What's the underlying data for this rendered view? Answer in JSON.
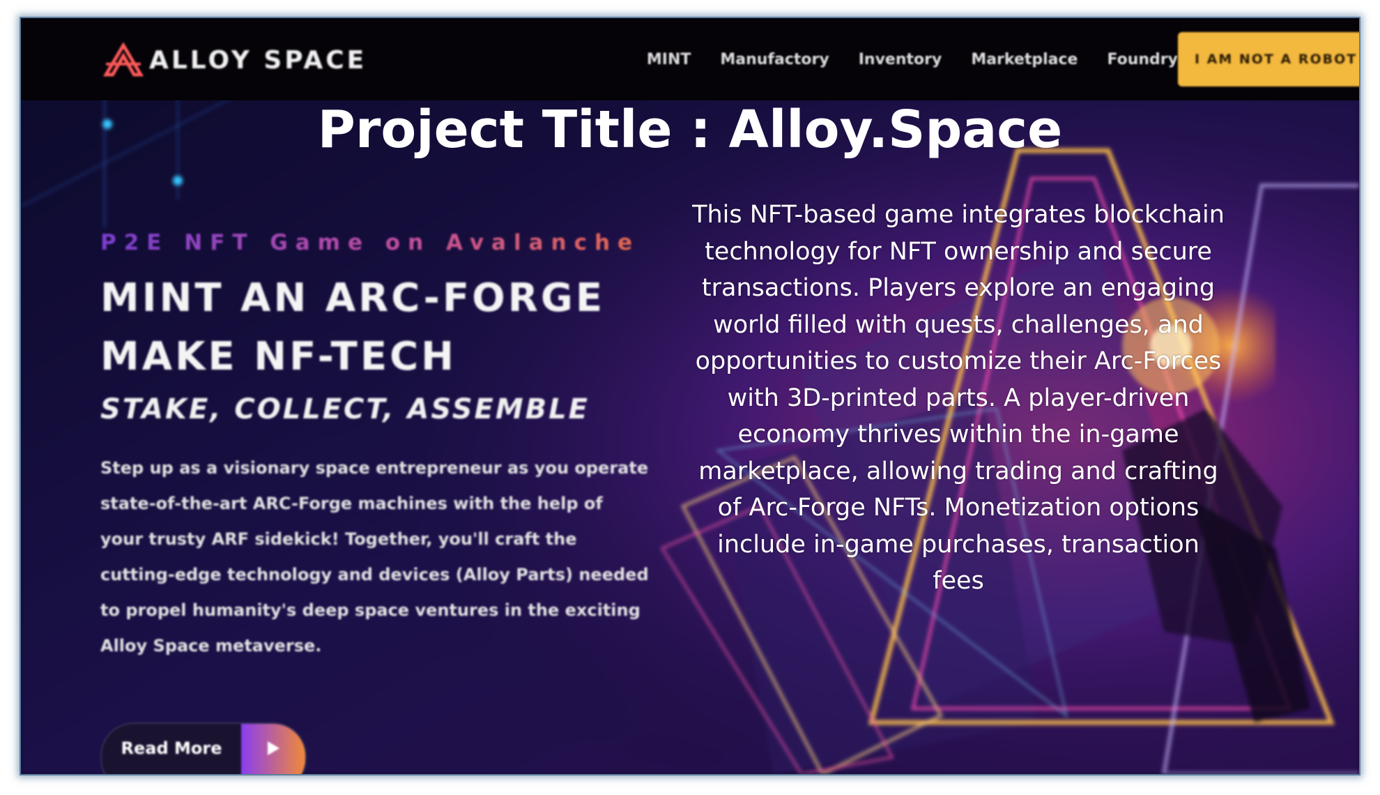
{
  "site": {
    "logo_text": "ALLOY SPACE",
    "nav": [
      "MINT",
      "Manufactory",
      "Inventory",
      "Marketplace",
      "Foundry"
    ],
    "cta_label": "I AM NOT A ROBOT"
  },
  "overlay": {
    "title": "Project Title : Alloy.Space",
    "description": "This NFT-based game integrates blockchain technology for NFT ownership and secure transactions. Players explore an engaging world filled with quests, challenges, and opportunities to customize their Arc-Forces with 3D-printed parts. A player-driven economy thrives within the in-game marketplace, allowing trading and crafting of Arc-Forge NFTs. Monetization options include in-game purchases, transaction fees"
  },
  "hero": {
    "tagline": "P2E NFT Game on Avalanche",
    "headline_line1": "MINT AN ARC-FORGE",
    "headline_line2": "MAKE NF-TECH",
    "subheadline": "STAKE, COLLECT, ASSEMBLE",
    "body": "Step up as a visionary space entrepreneur as you operate state-of-the-art ARC-Forge machines with the help of your trusty ARF sidekick! Together, you'll craft the cutting-edge technology and devices (Alloy Parts) needed to propel humanity's deep space ventures in the exciting Alloy Space metaverse.",
    "read_more_label": "Read More"
  },
  "colors": {
    "nav_bg": "#050308",
    "cta_bg": "#f3b83e",
    "hero_bg": "#120b33",
    "accent_purple": "#8a3df0",
    "accent_orange": "#f08a3a",
    "neon_pink": "#ff4fb0"
  },
  "icons": [
    "alloy-space-logo-icon",
    "play-arrow-icon"
  ]
}
